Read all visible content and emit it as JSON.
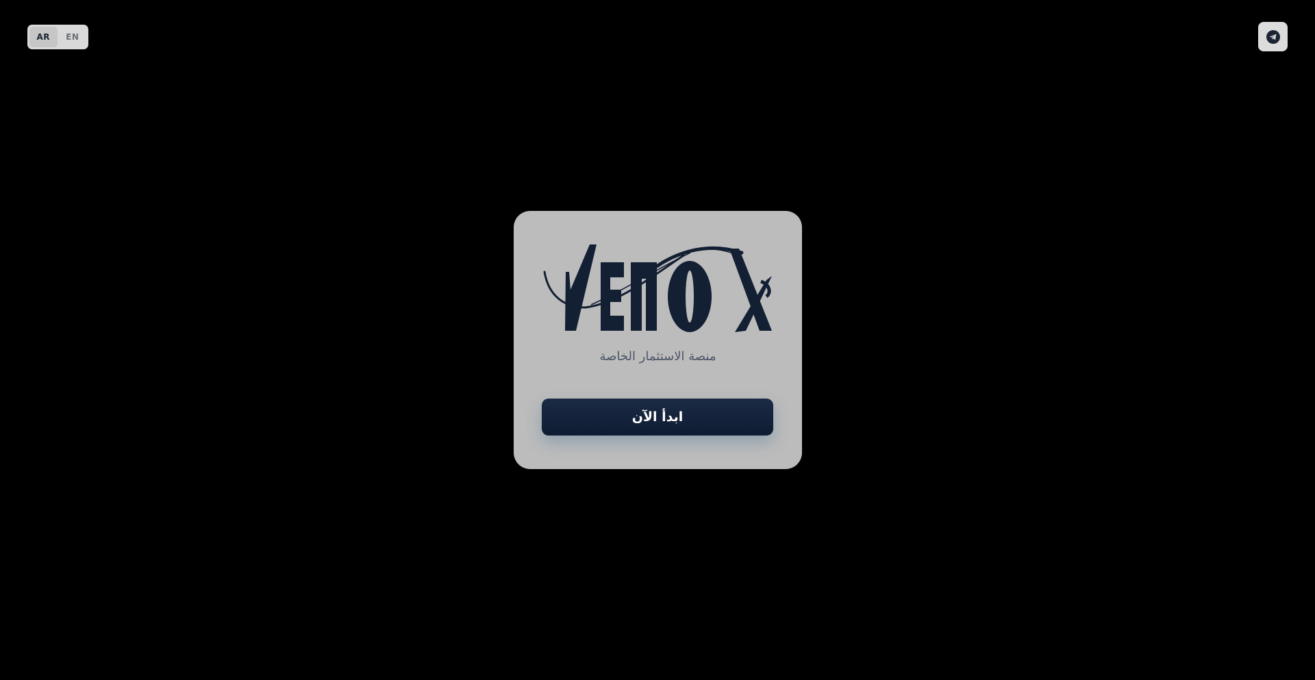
{
  "language_switch": {
    "options": [
      {
        "label": "AR",
        "active": true
      },
      {
        "label": "EN",
        "active": false
      }
    ]
  },
  "telegram_button": {
    "icon": "telegram-icon"
  },
  "card": {
    "logo_text": "VENOX",
    "subtitle": "منصة الاستثمار الخاصة",
    "start_button_label": "ابدأ الآن"
  },
  "colors": {
    "background": "#000000",
    "card": "#bcbcbc",
    "brand_navy": "#0e1c33"
  }
}
